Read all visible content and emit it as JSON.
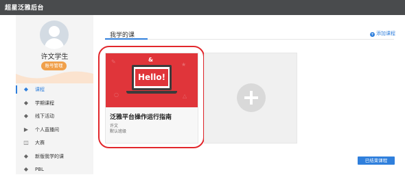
{
  "app": {
    "title": "超星泛雅后台"
  },
  "profile": {
    "name": "许文学生",
    "account_button": "账号管理"
  },
  "nav": [
    {
      "label": "课程",
      "icon": "cap-icon",
      "active": true
    },
    {
      "label": "学期课程",
      "icon": "cap-icon",
      "active": false
    },
    {
      "label": "线下活动",
      "icon": "cap-icon",
      "active": false
    },
    {
      "label": "个人直播间",
      "icon": "play-circle-icon",
      "active": false
    },
    {
      "label": "大赛",
      "icon": "book-icon",
      "active": false
    },
    {
      "label": "新版我学的课",
      "icon": "cap-icon",
      "active": false
    },
    {
      "label": "PBL",
      "icon": "cap-icon",
      "active": false
    }
  ],
  "main": {
    "tab": "我学的课",
    "add_course": "添加课程",
    "finished_button": "已结束课程"
  },
  "course_card": {
    "cover_text": "Hello!",
    "title": "泛雅平台操作运行指南",
    "teacher": "许文",
    "class": "默认班级"
  },
  "colors": {
    "accent": "#2f7fdc",
    "cover_red": "#e0353a",
    "highlight": "#e2262b",
    "topbar": "#494b4d"
  }
}
